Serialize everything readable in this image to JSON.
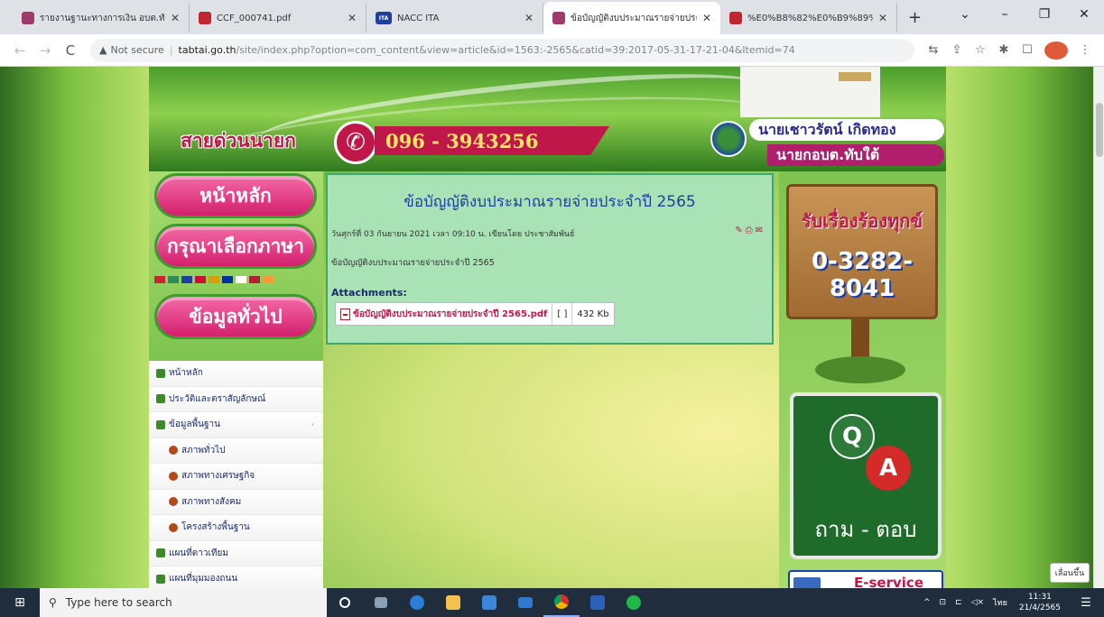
{
  "browser": {
    "tabs": [
      {
        "title": "รายงานฐานะทางการเงิน อบต.ทับใต้",
        "favicon_color": "#a03a6a",
        "active": false
      },
      {
        "title": "CCF_000741.pdf",
        "favicon_color": "#c0262d",
        "active": false
      },
      {
        "title": "NACC ITA",
        "favicon_color": "#1c3fa0",
        "favicon_text": "ITA",
        "active": false
      },
      {
        "title": "ข้อบัญญัติงบประมาณรายจ่ายประจำ",
        "favicon_color": "#a03a6a",
        "active": true
      },
      {
        "title": "%E0%B8%82%E0%B9%89%",
        "favicon_color": "#c0262d",
        "active": false
      }
    ],
    "new_tab": "+",
    "window_controls": [
      "⌄",
      "–",
      "❐",
      "✕"
    ],
    "security_text": "Not secure",
    "url_host": "tabtai.go.th",
    "url_path": "/site/index.php?option=com_content&view=article&id=1563:-2565&catid=39:2017-05-31-17-21-04&Itemid=74",
    "nav": {
      "back": "←",
      "forward": "→",
      "reload": "C"
    },
    "toolbar_icons": [
      "⇆",
      "⇪",
      "☆",
      "✱",
      "☐",
      "⋮"
    ]
  },
  "header": {
    "hotline_label": "สายด่วนนายก",
    "phone_number": "096 - 3943256",
    "phone_glyph": "✆",
    "mayor_name": "นายเชาวรัตน์ เกิดทอง",
    "mayor_title": "นายกอบต.ทับใต้"
  },
  "leftnav": {
    "home_pill": "หน้าหลัก",
    "language_pill": "กรุณาเลือกภาษา",
    "info_pill": "ข้อมูลทั่วไป",
    "flag_colors": [
      "#cc2233",
      "#2e8b57",
      "#1c3fa0",
      "#c8102e",
      "#d6a000",
      "#003399",
      "#ffffff",
      "#b22234",
      "#ff9933"
    ],
    "menu": [
      {
        "label": "หน้าหลัก",
        "sub": false,
        "arrow": ""
      },
      {
        "label": "ประวัติและตราสัญลักษณ์",
        "sub": false,
        "arrow": ""
      },
      {
        "label": "ข้อมูลพื้นฐาน",
        "sub": false,
        "arrow": "›"
      },
      {
        "label": "สภาพทั่วไป",
        "sub": true,
        "arrow": ""
      },
      {
        "label": "สภาพทางเศรษฐกิจ",
        "sub": true,
        "arrow": ""
      },
      {
        "label": "สภาพทางสังคม",
        "sub": true,
        "arrow": ""
      },
      {
        "label": "โครงสร้างพื้นฐาน",
        "sub": true,
        "arrow": ""
      },
      {
        "label": "แผนที่ดาวเทียม",
        "sub": false,
        "arrow": ""
      },
      {
        "label": "แผนที่มุมมองถนน",
        "sub": false,
        "arrow": ""
      }
    ]
  },
  "article": {
    "title": "ข้อบัญญัติงบประมาณรายจ่ายประจำปี 2565",
    "meta": "วันศุกร์ที่ 03 กันยายน 2021 เวลา 09:10 น. เขียนโดย ประชาสัมพันธ์",
    "body": "ข้อบัญญัติงบประมาณรายจ่ายประจำปี 2565",
    "attachments_label": "Attachments:",
    "attachment": {
      "name": "ข้อบัญญัติงบประมาณรายจ่ายประจำปี 2565.pdf",
      "bracket": "[ ]",
      "size": "432 Kb"
    },
    "tool_icons": [
      "✎",
      "⎙",
      "✉"
    ]
  },
  "rightcol": {
    "sign_line1": "รับเรื่องร้องทุกข์",
    "sign_line2": "0-3282-8041",
    "qa_q": "Q",
    "qa_a": "A",
    "qa_label": "ถาม - ตอบ",
    "eservice": "E-service"
  },
  "page_button": "เลื่อนขึ้น",
  "taskbar": {
    "start_glyph": "⊞",
    "search_glyph": "⚲",
    "search_placeholder": "Type here to search",
    "apps": [
      {
        "name": "cortana",
        "color": "#ffffff",
        "active": false
      },
      {
        "name": "task-view",
        "color": "#8aa0b8",
        "active": false
      },
      {
        "name": "edge",
        "color": "#2b7fd8",
        "active": false
      },
      {
        "name": "file-explorer",
        "color": "#f2c14e",
        "active": false
      },
      {
        "name": "store",
        "color": "#3a86d8",
        "active": false
      },
      {
        "name": "mail",
        "color": "#2f7ad0",
        "active": false
      },
      {
        "name": "chrome",
        "color": "#e0b030",
        "active": true
      },
      {
        "name": "word",
        "color": "#2b5fb8",
        "active": false
      },
      {
        "name": "line",
        "color": "#21b84a",
        "active": false
      }
    ],
    "tray_icons": [
      "^",
      "⊡",
      "⊏",
      "◁×"
    ],
    "language": "ไทย",
    "time": "11:31",
    "date": "21/4/2565",
    "notification_glyph": "☰"
  }
}
